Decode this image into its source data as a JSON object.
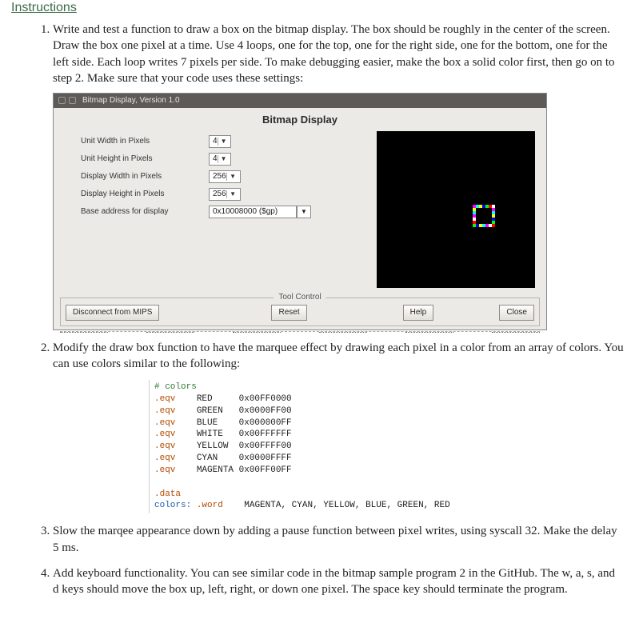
{
  "header": {
    "title": "Instructions"
  },
  "items": {
    "1": "Write and test a function to draw a box on the bitmap display. The box should be roughly in the center of the screen. Draw the box one pixel at a time. Use 4 loops, one for the top, one for the right side, one for the bottom, one for the left side. Each loop writes 7 pixels per side. To make debugging easier, make the box a solid color first, then go on to step 2. Make sure that your code uses these settings:",
    "2": "Modify the draw box function to have the marquee effect by drawing each pixel in a color from an array of colors. You can use colors similar to the following:",
    "3": "Slow the marqee appearance down by adding a pause function between pixel writes, using syscall 32. Make the delay 5 ms.",
    "4": "Add keyboard functionality. You can see similar code in the bitmap sample program 2 in the GitHub. The w, a, s, and d keys should move the box up, left, right, or down one pixel. The space key should terminate the program."
  },
  "bmp": {
    "titlebar": "Bitmap Display, Version 1.0",
    "heading": "Bitmap Display",
    "settings": {
      "unit_w": {
        "label": "Unit Width in Pixels",
        "value": "4"
      },
      "unit_h": {
        "label": "Unit Height in Pixels",
        "value": "4"
      },
      "disp_w": {
        "label": "Display Width in Pixels",
        "value": "256"
      },
      "disp_h": {
        "label": "Display Height in Pixels",
        "value": "256"
      },
      "base": {
        "label": "Base address for display",
        "value": "0x10008000 ($gp)"
      }
    },
    "tool": {
      "legend": "Tool Control",
      "disconnect": "Disconnect from MIPS",
      "reset": "Reset",
      "help": "Help",
      "close": "Close"
    },
    "box_colors": [
      "#ff00ff",
      "#00ffff",
      "#ffff00",
      "#0000ff",
      "#00ff00",
      "#ff0000",
      "#ffffff"
    ]
  },
  "code": {
    "comment": "# colors",
    "eqv": ".eqv",
    "defs": [
      {
        "name": "RED",
        "hex": "0x00FF0000"
      },
      {
        "name": "GREEN",
        "hex": "0x0000FF00"
      },
      {
        "name": "BLUE",
        "hex": "0x000000FF"
      },
      {
        "name": "WHITE",
        "hex": "0x00FFFFFF"
      },
      {
        "name": "YELLOW",
        "hex": "0x00FFFF00"
      },
      {
        "name": "CYAN",
        "hex": "0x0000FFFF"
      },
      {
        "name": "MAGENTA",
        "hex": "0x00FF00FF"
      }
    ],
    "data_dir": ".data",
    "colors_label": "colors:",
    "word_dir": ".word",
    "colors_list": "MAGENTA, CYAN, YELLOW, BLUE, GREEN, RED"
  }
}
